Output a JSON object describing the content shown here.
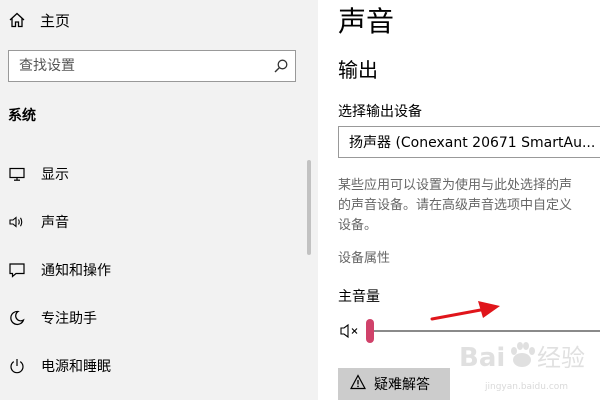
{
  "sidebar": {
    "home_label": "主页",
    "search_placeholder": "查找设置",
    "section_title": "系统",
    "items": [
      {
        "label": "显示",
        "icon": "monitor-icon"
      },
      {
        "label": "声音",
        "icon": "speaker-icon"
      },
      {
        "label": "通知和操作",
        "icon": "notification-icon"
      },
      {
        "label": "专注助手",
        "icon": "moon-icon"
      },
      {
        "label": "电源和睡眠",
        "icon": "power-icon"
      }
    ]
  },
  "main": {
    "page_title": "声音",
    "output_heading": "输出",
    "device_label": "选择输出设备",
    "device_value": "扬声器 (Conexant 20671 SmartAu...",
    "description_lines": [
      "某些应用可以设置为使用与此处选择的声",
      "的声音设备。请在高级声音选项中自定义",
      "设备。"
    ],
    "device_properties_link": "设备属性",
    "master_volume_label": "主音量",
    "volume_level": 0,
    "troubleshoot_label": "疑难解答"
  },
  "colors": {
    "sidebar_bg": "#f2f2f2",
    "slider_thumb": "#d0426a",
    "annotation_arrow": "#e0151b",
    "button_bg": "#cccccc"
  },
  "watermark": {
    "text": "Bai du 经验",
    "sub": "jingyan.baidu.com"
  }
}
